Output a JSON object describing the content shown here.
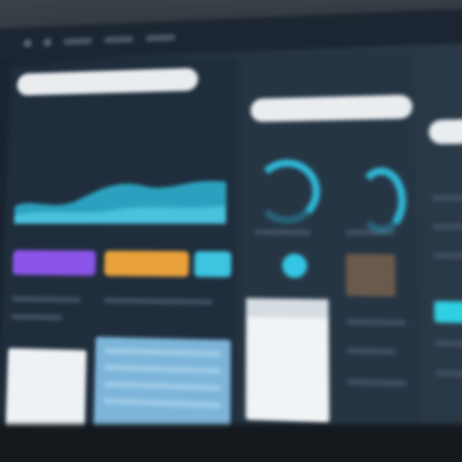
{
  "colors": {
    "accent_cyan": "#34c6e4",
    "accent_purple": "#8a55e8",
    "accent_orange": "#e8a13a",
    "panel_dark": "#1f2d3c",
    "doc_blue": "#7cb5d9"
  },
  "icons": [
    "window-dot-icon",
    "donut-chart-icon",
    "status-dot-icon"
  ]
}
